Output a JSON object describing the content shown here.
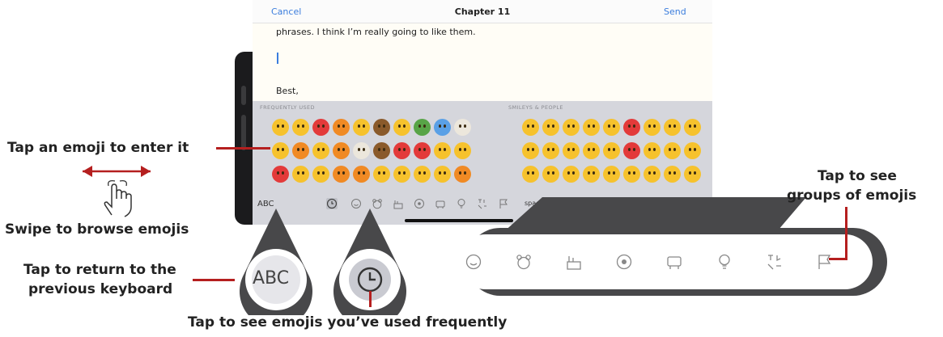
{
  "window": {
    "cancel": "Cancel",
    "title": "Chapter 11",
    "send": "Send"
  },
  "compose": {
    "line1": "phrases. I think I’m really going to like them.",
    "line2": "Best,"
  },
  "keyboard": {
    "frequently_used": "FREQUENTLY USED",
    "smileys_people": "SMILEYS & PEOPLE",
    "abc": "ABC",
    "space": "space",
    "categories": [
      "clock-icon",
      "smiley-icon",
      "bear-icon",
      "food-icon",
      "ball-icon",
      "car-icon",
      "bulb-icon",
      "symbols-icon",
      "flag-icon"
    ]
  },
  "callouts": {
    "abc_magnified": "ABC",
    "tap_emoji": "Tap an emoji to enter it",
    "swipe": "Swipe to browse emojis",
    "return_line1": "Tap to return to the",
    "return_line2": "previous keyboard",
    "frequent": "Tap to see emojis you’ve used frequently",
    "groups_line1": "Tap to see",
    "groups_line2": "groups of emojis"
  },
  "colors": {
    "accent": "#3b7ddd",
    "callout_line": "#b51f1f",
    "callout_fill": "#48484a"
  }
}
